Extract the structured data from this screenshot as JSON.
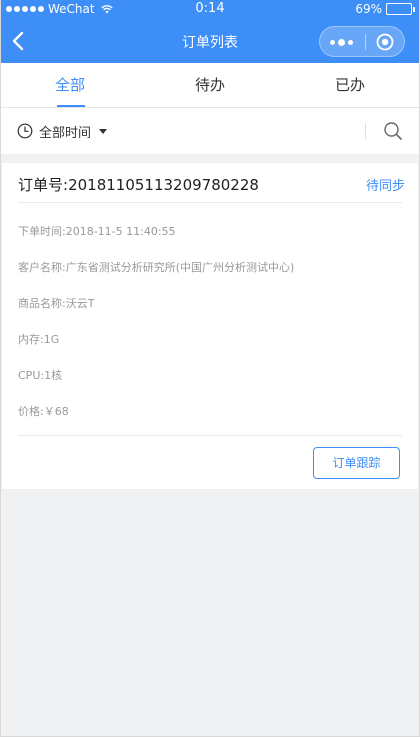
{
  "status_bar": {
    "carrier": "WeChat",
    "time": "0:14",
    "battery": "69%",
    "battery_level": 0.69
  },
  "nav": {
    "title": "订单列表"
  },
  "tabs": [
    {
      "label": "全部",
      "active": true
    },
    {
      "label": "待办",
      "active": false
    },
    {
      "label": "已办",
      "active": false
    }
  ],
  "filter": {
    "time_label": "全部时间"
  },
  "order": {
    "number_label": "订单号:",
    "number": "20181105113209780228",
    "status": "待同步",
    "fields": [
      {
        "label": "下单时间:",
        "value": "2018-11-5 11:40:55"
      },
      {
        "label": "客户名称:",
        "value": "广东省测试分析研究所(中国广州分析测试中心)"
      },
      {
        "label": "商品名称:",
        "value": "沃云T"
      },
      {
        "label": "内存:",
        "value": "1G"
      },
      {
        "label": "CPU:",
        "value": "1核"
      },
      {
        "label": "价格:",
        "value": "￥68"
      }
    ],
    "track_button": "订单跟踪"
  },
  "colors": {
    "accent": "#3e8ef7",
    "background": "#eff1f3"
  }
}
